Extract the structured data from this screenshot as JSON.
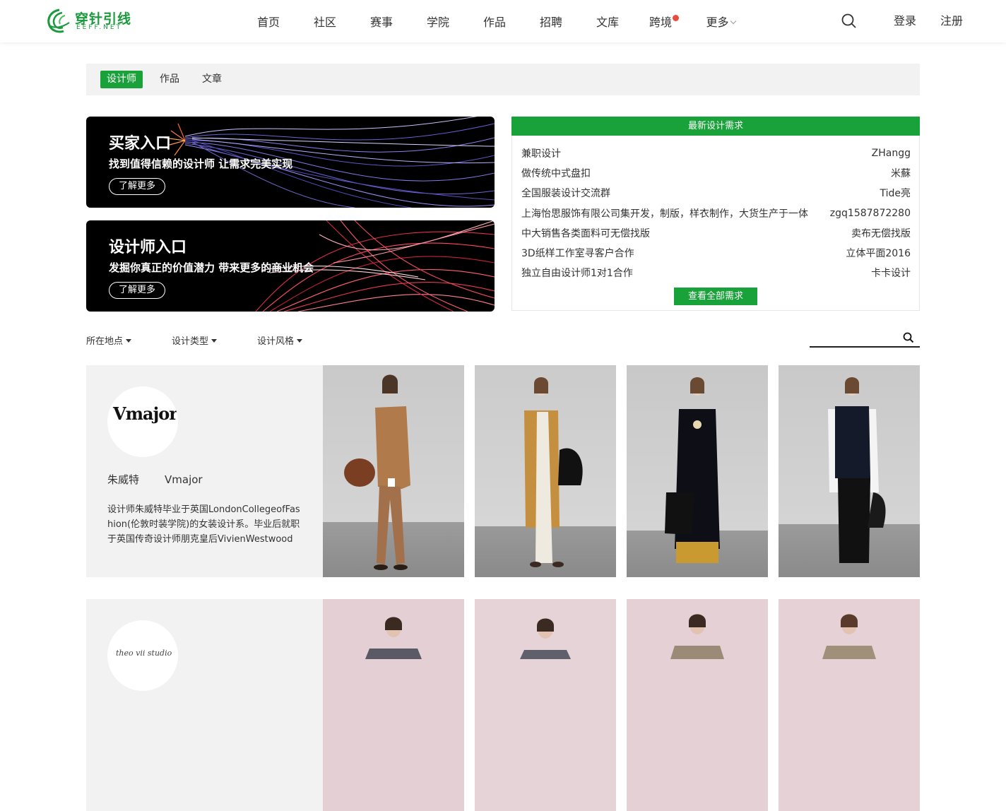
{
  "brand": {
    "name": "穿针引线",
    "sub": "EEFF.NET",
    "color": "#1aa23a"
  },
  "nav": [
    {
      "label": "首页"
    },
    {
      "label": "社区"
    },
    {
      "label": "赛事"
    },
    {
      "label": "学院"
    },
    {
      "label": "作品"
    },
    {
      "label": "招聘"
    },
    {
      "label": "文库"
    },
    {
      "label": "跨境"
    },
    {
      "label": "更多"
    }
  ],
  "auth": {
    "login": "登录",
    "register": "注册"
  },
  "tabs": [
    {
      "label": "设计师",
      "active": true
    },
    {
      "label": "作品"
    },
    {
      "label": "文章"
    }
  ],
  "banners": [
    {
      "title": "买家入口",
      "subtitle": "找到值得信赖的设计师 让需求完美实现",
      "button": "了解更多"
    },
    {
      "title": "设计师入口",
      "subtitle": "发掘你真正的价值潜力 带来更多的商业机会",
      "button": "了解更多"
    }
  ],
  "demand": {
    "title": "最新设计需求",
    "items": [
      {
        "title": "兼职设计",
        "user": "ZHangg"
      },
      {
        "title": "做传统中式盘扣",
        "user": "米蘇"
      },
      {
        "title": "全国服装设计交流群",
        "user": "Tide亮"
      },
      {
        "title": "上海怡思服饰有限公司集开发，制版，样衣制作，大货生产于一体",
        "user": "zgq1587872280"
      },
      {
        "title": "中大销售各类面料可无偿找版",
        "user": "卖布无偿找版"
      },
      {
        "title": "3D纸样工作室寻客户合作",
        "user": "立体平面2016"
      },
      {
        "title": "独立自由设计师1对1合作",
        "user": "卡卡设计"
      }
    ],
    "button": "查看全部需求"
  },
  "filters": [
    {
      "label": "所在地点"
    },
    {
      "label": "设计类型"
    },
    {
      "label": "设计风格"
    }
  ],
  "designers": [
    {
      "avatar_text": "Vmajor",
      "name": "朱威特",
      "brand": "Vmajor",
      "desc": "设计师朱威特毕业于英国LondonCollegeofFashion(伦敦时装学院)的女装设计系。毕业后就职于英国传奇设计师朋克皇后VivienWestwood"
    },
    {
      "avatar_text": "theo vii studio"
    }
  ]
}
